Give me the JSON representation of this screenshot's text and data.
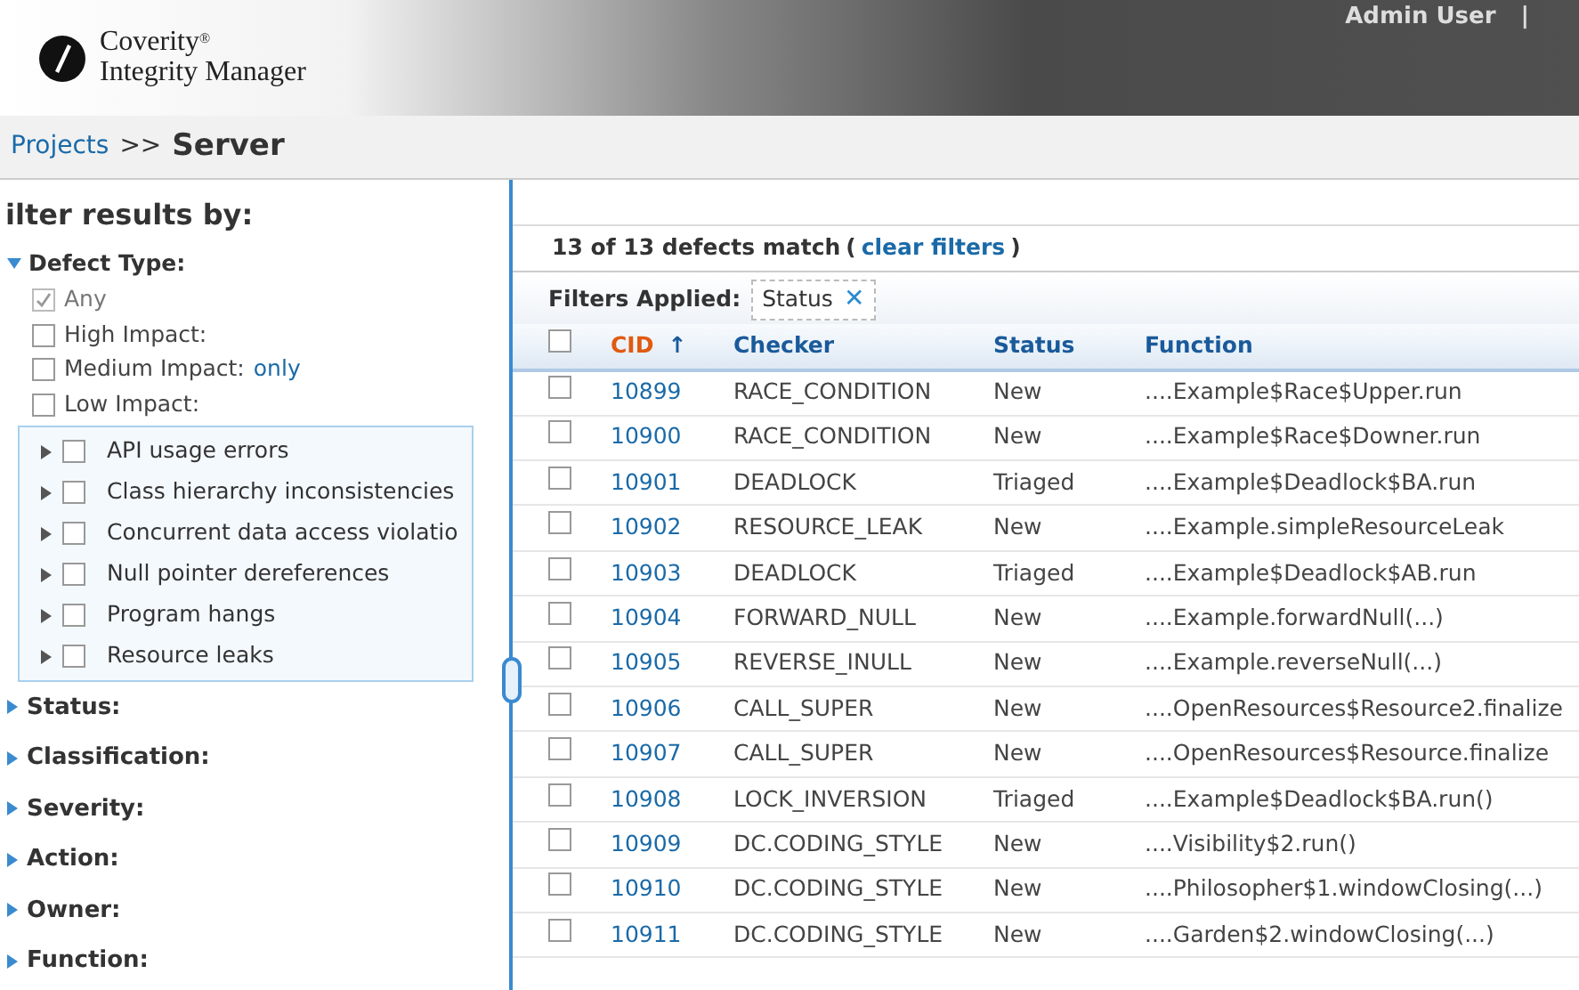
{
  "header": {
    "logo_line1": "Coverity",
    "logo_mark": "®",
    "logo_line2": "Integrity Manager",
    "user": "Admin User",
    "separator": "|"
  },
  "breadcrumb": {
    "link": "Projects",
    "separator": ">>",
    "current": "Server"
  },
  "filters": {
    "title": "ilter results by:",
    "section": {
      "label": "Defect Type:",
      "expanded": true,
      "options": [
        {
          "label": "Any",
          "checked": true,
          "disabled": true
        },
        {
          "label": "High Impact:",
          "checked": false,
          "disabled": false
        },
        {
          "label": "Medium Impact:",
          "link": "only",
          "checked": false,
          "disabled": false
        },
        {
          "label": "Low Impact:",
          "checked": false,
          "disabled": false
        }
      ],
      "categories": [
        {
          "label": "API usage errors",
          "checked": false
        },
        {
          "label": "Class hierarchy inconsistencies",
          "checked": false
        },
        {
          "label": "Concurrent data access violatio",
          "checked": false
        },
        {
          "label": "Null pointer dereferences",
          "checked": false
        },
        {
          "label": "Program hangs",
          "checked": false
        },
        {
          "label": "Resource leaks",
          "checked": false
        }
      ]
    },
    "collapsed_sections": [
      {
        "label": "Status:",
        "expanded": false
      },
      {
        "label": "Classification:",
        "expanded": false
      },
      {
        "label": "Severity:",
        "expanded": false
      },
      {
        "label": "Action:",
        "expanded": false
      },
      {
        "label": "Owner:",
        "expanded": false
      },
      {
        "label": "Function:",
        "expanded": false
      }
    ]
  },
  "results": {
    "summary": "13 of 13 defects match",
    "open_paren": "(",
    "clear_link": "clear filters",
    "close_paren": ")",
    "filters_label": "Filters Applied:",
    "applied": [
      "Status"
    ],
    "remove_symbol": "✕",
    "columns": [
      {
        "label": "CID",
        "sorted": true,
        "sort_symbol": "↑"
      },
      {
        "label": "Checker",
        "sorted": false
      },
      {
        "label": "Status",
        "sorted": false
      },
      {
        "label": "Function",
        "sorted": false
      }
    ],
    "select_all": false,
    "rows": [
      {
        "cid": "10899",
        "checker": "RACE_CONDITION",
        "status": "New",
        "function": "....Example$Race$Upper.run",
        "checked": false
      },
      {
        "cid": "10900",
        "checker": "RACE_CONDITION",
        "status": "New",
        "function": "....Example$Race$Downer.run",
        "checked": false
      },
      {
        "cid": "10901",
        "checker": "DEADLOCK",
        "status": "Triaged",
        "function": "....Example$Deadlock$BA.run",
        "checked": false
      },
      {
        "cid": "10902",
        "checker": "RESOURCE_LEAK",
        "status": "New",
        "function": "....Example.simpleResourceLeak",
        "checked": false
      },
      {
        "cid": "10903",
        "checker": "DEADLOCK",
        "status": "Triaged",
        "function": "....Example$Deadlock$AB.run",
        "checked": false
      },
      {
        "cid": "10904",
        "checker": "FORWARD_NULL",
        "status": "New",
        "function": "....Example.forwardNull(...)",
        "checked": false
      },
      {
        "cid": "10905",
        "checker": "REVERSE_INULL",
        "status": "New",
        "function": "....Example.reverseNull(...)",
        "checked": false
      },
      {
        "cid": "10906",
        "checker": "CALL_SUPER",
        "status": "New",
        "function": "....OpenResources$Resource2.finalize",
        "checked": false
      },
      {
        "cid": "10907",
        "checker": "CALL_SUPER",
        "status": "New",
        "function": "....OpenResources$Resource.finalize",
        "checked": false
      },
      {
        "cid": "10908",
        "checker": "LOCK_INVERSION",
        "status": "Triaged",
        "function": "....Example$Deadlock$BA.run()",
        "checked": false
      },
      {
        "cid": "10909",
        "checker": "DC.CODING_STYLE",
        "status": "New",
        "function": "....Visibility$2.run()",
        "checked": false
      },
      {
        "cid": "10910",
        "checker": "DC.CODING_STYLE",
        "status": "New",
        "function": "....Philosopher$1.windowClosing(...)",
        "checked": false
      },
      {
        "cid": "10911",
        "checker": "DC.CODING_STYLE",
        "status": "New",
        "function": "....Garden$2.windowClosing(...)",
        "checked": false
      }
    ]
  }
}
